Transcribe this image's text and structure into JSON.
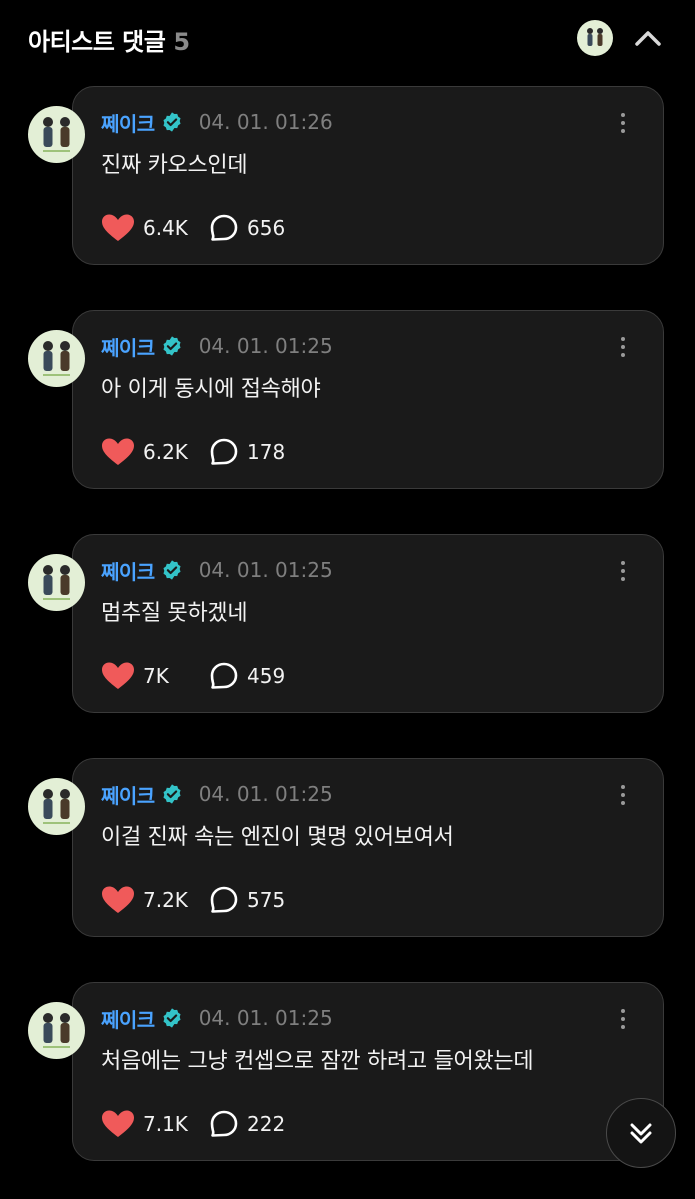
{
  "header": {
    "title": "아티스트 댓글",
    "count": "5"
  },
  "comments": [
    {
      "author": "쩨이크",
      "timestamp": "04. 01. 01:26",
      "text": "진짜 카오스인데",
      "likes": "6.4K",
      "replies": "656"
    },
    {
      "author": "쩨이크",
      "timestamp": "04. 01. 01:25",
      "text": "아 이게 동시에 접속해야",
      "likes": "6.2K",
      "replies": "178"
    },
    {
      "author": "쩨이크",
      "timestamp": "04. 01. 01:25",
      "text": "멈추질 못하겠네",
      "likes": "7K",
      "replies": "459"
    },
    {
      "author": "쩨이크",
      "timestamp": "04. 01. 01:25",
      "text": "이걸 진짜 속는 엔진이 몇명 있어보여서",
      "likes": "7.2K",
      "replies": "575"
    },
    {
      "author": "쩨이크",
      "timestamp": "04. 01. 01:25",
      "text": "처음에는 그냥 컨셉으로 잠깐 하려고 들어왔는데",
      "likes": "7.1K",
      "replies": "222"
    }
  ],
  "icons": {
    "header_avatar": "artist-avatar-icon",
    "collapse": "chevron-up-icon",
    "verified": "verified-badge-icon",
    "like": "heart-icon",
    "reply": "speech-bubble-icon",
    "more": "more-vertical-icon",
    "scroll": "double-chevron-down-icon"
  },
  "colors": {
    "background": "#000000",
    "card": "#1a1a1a",
    "author": "#4aa3ff",
    "verified": "#33c3c8",
    "heart": "#f05a5a",
    "timestamp": "#7f7f7f",
    "count": "#8a8a8a"
  }
}
